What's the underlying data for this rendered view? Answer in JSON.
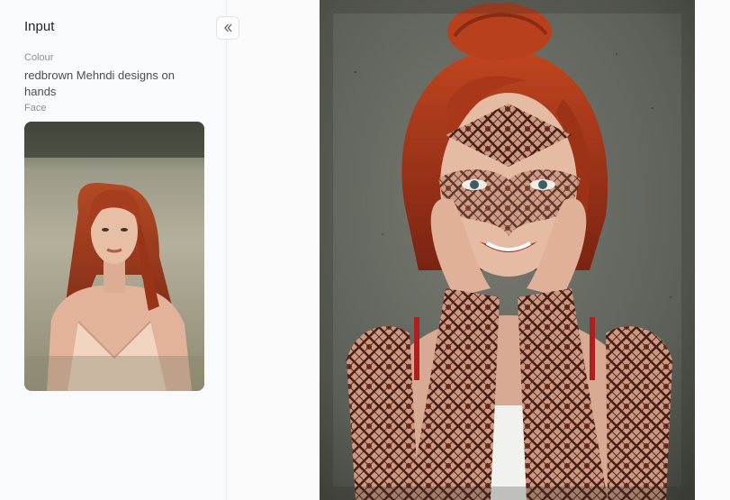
{
  "panel": {
    "title": "Input",
    "collapse_icon": "double-chevron-left-icon",
    "colour_label": "Colour",
    "colour_value": "redbrown Mehndi designs on hands",
    "face_label": "Face"
  },
  "images": {
    "face_input": "photo: red-haired woman in light slip dress seated in a field",
    "result": "photo: red-haired woman with hands on cheeks, face and arms covered in red-brown mehndi patterns"
  },
  "colors": {
    "sidebar_bg": "#f9fafb",
    "text_primary": "#1f2328",
    "text_muted": "#8a8f98",
    "wall": "#5f625b",
    "hair": "#a8361c",
    "henna": "#6a2a1b"
  }
}
